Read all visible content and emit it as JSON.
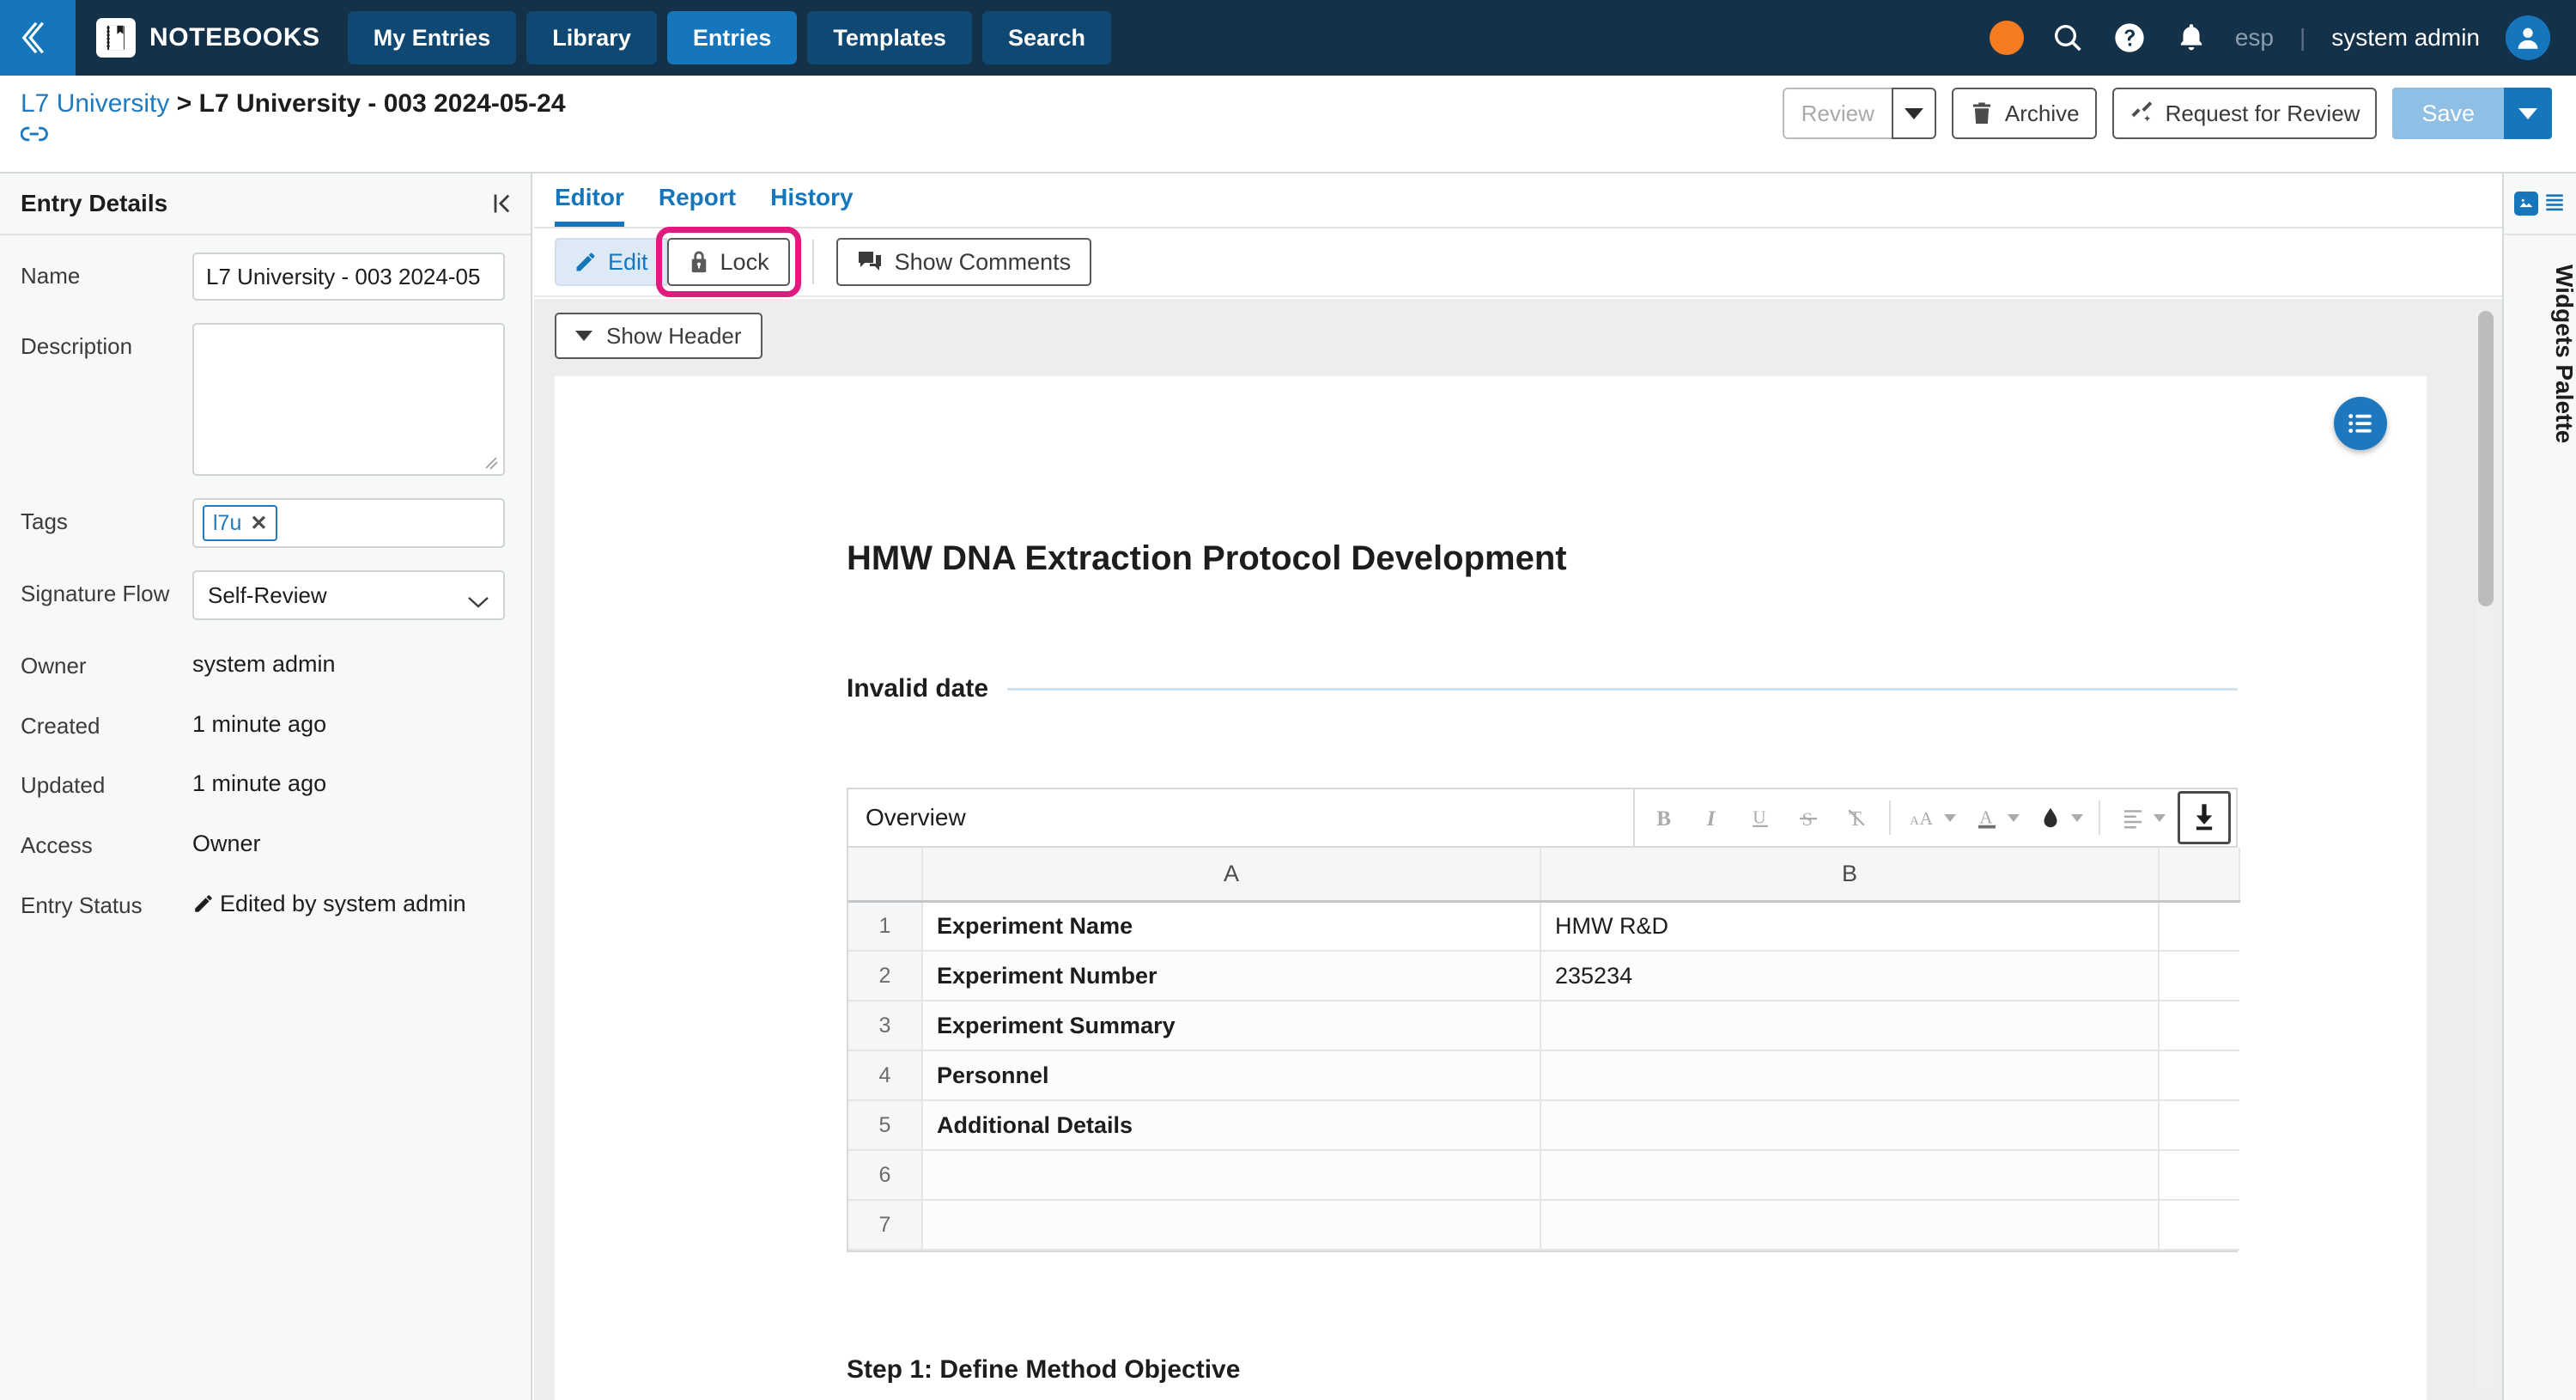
{
  "topbar": {
    "collapse_icon": "chevron-left-double-icon",
    "brand_icon": "notebook-icon",
    "brand": "NOTEBOOKS",
    "tabs": [
      {
        "label": "My Entries",
        "active": false
      },
      {
        "label": "Library",
        "active": false
      },
      {
        "label": "Entries",
        "active": true
      },
      {
        "label": "Templates",
        "active": false
      },
      {
        "label": "Search",
        "active": false
      }
    ],
    "status_dot_color": "#f47b20",
    "search_icon": "search-icon",
    "help_icon": "help-circle-icon",
    "bell_icon": "bell-icon",
    "language": "esp",
    "separator": "|",
    "username": "system admin",
    "avatar_icon": "user-avatar-icon"
  },
  "breadcrumb": {
    "parent": "L7 University",
    "separator": ">",
    "current": "L7 University - 003 2024-05-24",
    "link_icon": "link-chain-icon"
  },
  "header_actions": {
    "review_label": "Review",
    "review_caret_icon": "caret-down-icon",
    "archive_label": "Archive",
    "archive_icon": "trash-icon",
    "request_label": "Request for Review",
    "request_icon": "magic-wand-icon",
    "save_label": "Save",
    "save_caret_icon": "caret-down-icon"
  },
  "sidebar": {
    "title": "Entry Details",
    "collapse_icon": "collapse-left-icon",
    "fields": {
      "name_label": "Name",
      "name_value": "L7 University - 003 2024-05",
      "description_label": "Description",
      "description_value": "",
      "tags_label": "Tags",
      "tag_chip": "l7u",
      "tag_remove_icon": "close-x-icon",
      "signature_flow_label": "Signature Flow",
      "signature_flow_value": "Self-Review",
      "signature_flow_caret": "chevron-down-icon",
      "owner_label": "Owner",
      "owner_value": "system admin",
      "created_label": "Created",
      "created_value": "1 minute ago",
      "updated_label": "Updated",
      "updated_value": "1 minute ago",
      "access_label": "Access",
      "access_value": "Owner",
      "entry_status_label": "Entry Status",
      "entry_status_value": "Edited by system admin",
      "entry_status_icon": "pencil-icon"
    }
  },
  "editor": {
    "tabs": [
      {
        "label": "Editor",
        "active": true
      },
      {
        "label": "Report",
        "active": false
      },
      {
        "label": "History",
        "active": false
      }
    ],
    "toolbar": {
      "edit_label": "Edit",
      "edit_icon": "pencil-icon",
      "lock_label": "Lock",
      "lock_icon": "lock-icon",
      "lock_highlight_color": "#e2197f",
      "comments_label": "Show Comments",
      "comments_icon": "comment-icon"
    },
    "show_header_label": "Show Header",
    "show_header_caret": "caret-down-icon",
    "fab_icon": "list-menu-icon"
  },
  "document": {
    "title": "HMW DNA Extraction Protocol Development",
    "date_text": "Invalid date",
    "step_heading": "Step 1: Define Method Objective"
  },
  "spreadsheet": {
    "name": "Overview",
    "tools": [
      {
        "name": "bold-icon",
        "glyph": "B"
      },
      {
        "name": "italic-icon",
        "glyph": "I"
      },
      {
        "name": "underline-icon",
        "glyph": "U"
      },
      {
        "name": "strikethrough-icon",
        "glyph": "S"
      },
      {
        "name": "clear-format-icon",
        "glyph": "T"
      },
      {
        "name": "font-size-icon",
        "glyph": "AA"
      },
      {
        "name": "text-color-icon",
        "glyph": "A"
      },
      {
        "name": "fill-color-icon",
        "glyph": "drop"
      },
      {
        "name": "align-icon",
        "glyph": "lines"
      }
    ],
    "download_icon": "download-icon",
    "columns": [
      "",
      "A",
      "B",
      ""
    ],
    "rows": [
      {
        "num": "1",
        "a": "Experiment Name",
        "b": "HMW R&D"
      },
      {
        "num": "2",
        "a": "Experiment Number",
        "b": "235234"
      },
      {
        "num": "3",
        "a": "Experiment Summary",
        "b": ""
      },
      {
        "num": "4",
        "a": "Personnel",
        "b": ""
      },
      {
        "num": "5",
        "a": "Additional Details",
        "b": ""
      },
      {
        "num": "6",
        "a": "",
        "b": ""
      },
      {
        "num": "7",
        "a": "",
        "b": ""
      }
    ]
  },
  "widgets_palette": {
    "label": "Widgets Palette",
    "image_icon": "image-icon",
    "list_icon": "list-lines-icon"
  }
}
